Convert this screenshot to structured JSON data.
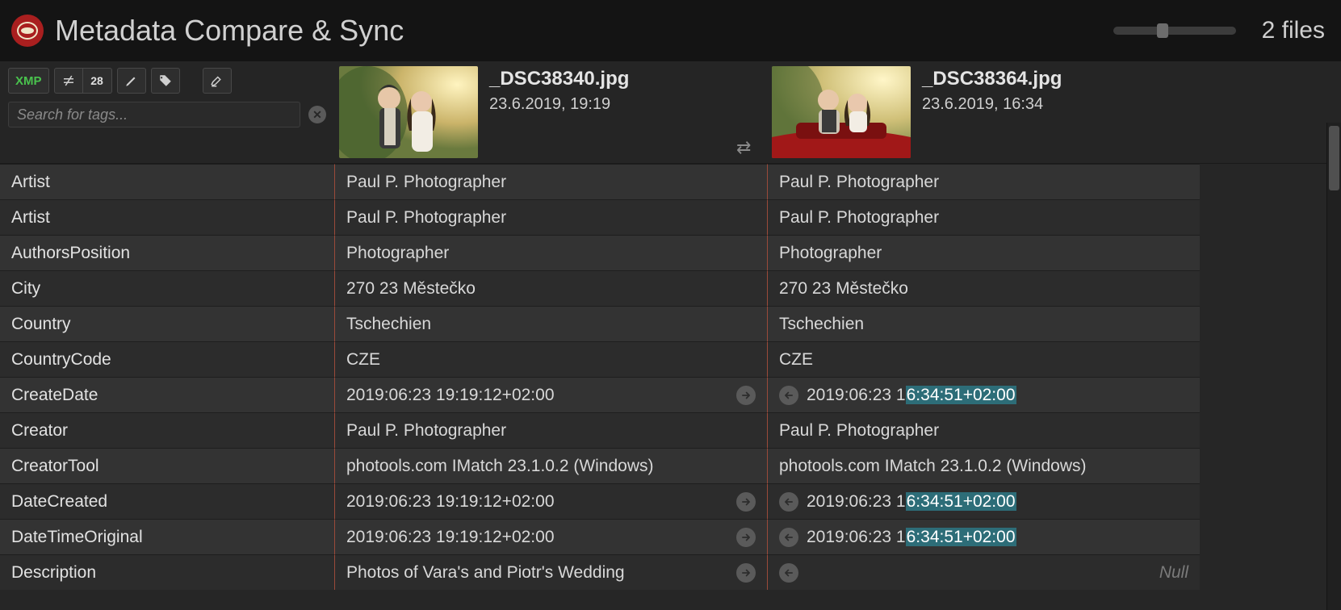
{
  "header": {
    "title": "Metadata Compare & Sync",
    "file_count": "2 files"
  },
  "toolbar": {
    "xmp": "XMP",
    "diff_count": "28",
    "search_placeholder": "Search for tags..."
  },
  "files": [
    {
      "name": "_DSC38340.jpg",
      "date": "23.6.2019, 19:19"
    },
    {
      "name": "_DSC38364.jpg",
      "date": "23.6.2019, 16:34"
    }
  ],
  "rows": [
    {
      "tag": "Artist",
      "a": "Paul P. Photographer",
      "b": "Paul P. Photographer"
    },
    {
      "tag": "Artist",
      "a": "Paul P. Photographer",
      "b": "Paul P. Photographer"
    },
    {
      "tag": "AuthorsPosition",
      "a": "Photographer",
      "b": "Photographer"
    },
    {
      "tag": "City",
      "a": "270 23 Městečko",
      "b": "270 23 Městečko"
    },
    {
      "tag": "Country",
      "a": "Tschechien",
      "b": "Tschechien"
    },
    {
      "tag": "CountryCode",
      "a": "CZE",
      "b": "CZE"
    },
    {
      "tag": "CreateDate",
      "a": "2019:06:23 19:19:12+02:00",
      "b_pre": "2019:06:23 1",
      "b_hl": "6:34:51+02:00",
      "diff": true
    },
    {
      "tag": "Creator",
      "a": "Paul P. Photographer",
      "b": "Paul P. Photographer"
    },
    {
      "tag": "CreatorTool",
      "a": "photools.com IMatch 23.1.0.2 (Windows)",
      "b": "photools.com IMatch 23.1.0.2 (Windows)"
    },
    {
      "tag": "DateCreated",
      "a": "2019:06:23 19:19:12+02:00",
      "b_pre": "2019:06:23 1",
      "b_hl": "6:34:51+02:00",
      "diff": true
    },
    {
      "tag": "DateTimeOriginal",
      "a": "2019:06:23 19:19:12+02:00",
      "b_pre": "2019:06:23 1",
      "b_hl": "6:34:51+02:00",
      "diff": true
    },
    {
      "tag": "Description",
      "a": "Photos of Vara's and Piotr's Wedding",
      "b_null": "Null",
      "diff": true
    }
  ]
}
